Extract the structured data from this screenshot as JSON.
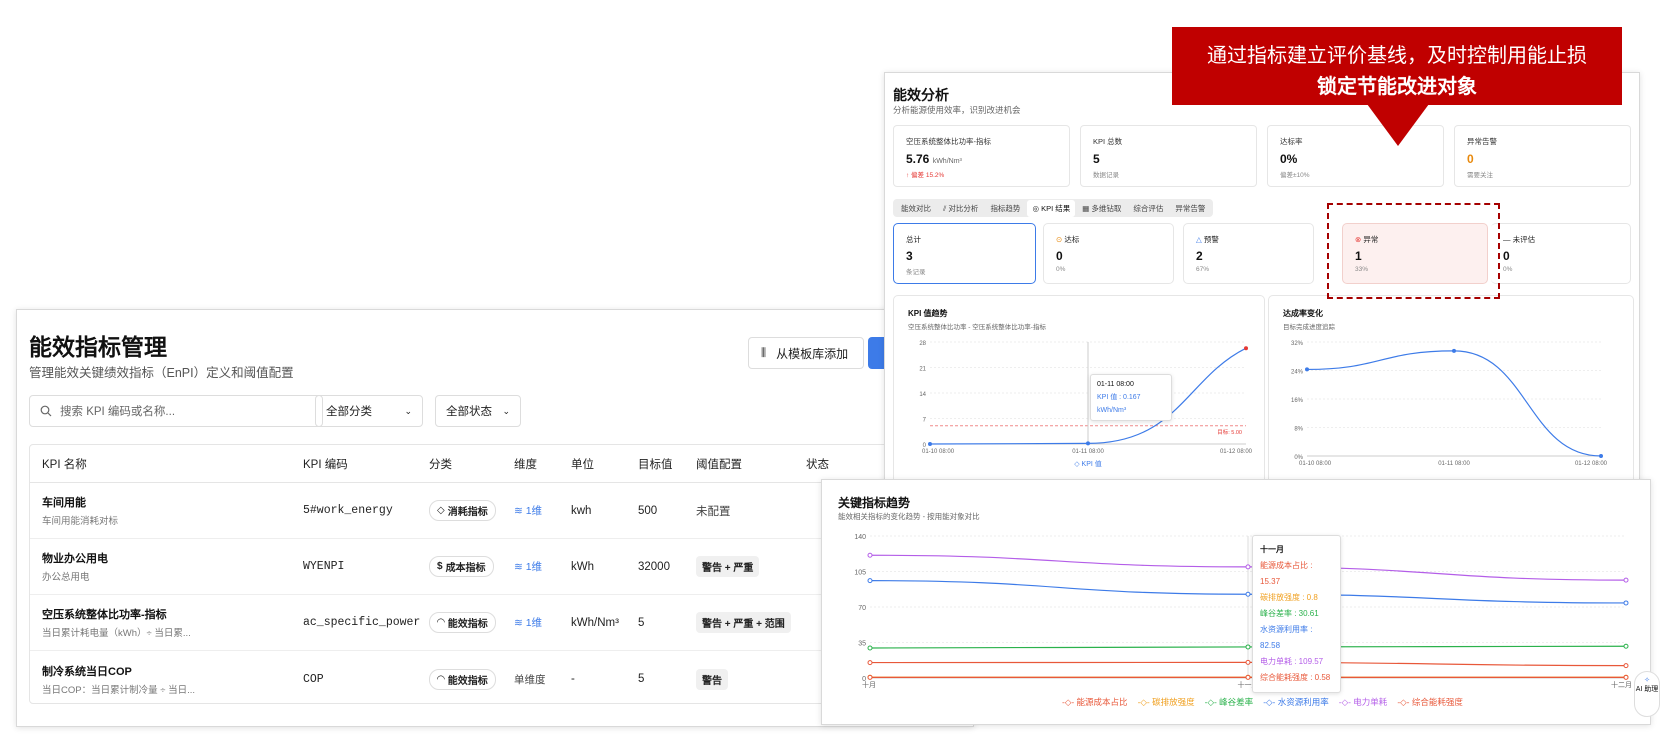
{
  "callout": {
    "line1": "通过指标建立评价基线，及时控制用能止损",
    "line2": "锁定节能改进对象"
  },
  "kpi_panel": {
    "title": "能效指标管理",
    "subtitle": "管理能效关键绩效指标（EnPI）定义和阈值配置",
    "template_btn": "从模板库添加",
    "search_placeholder": "搜索 KPI 编码或名称...",
    "filter_category": "全部分类",
    "filter_status": "全部状态",
    "columns": [
      "KPI 名称",
      "KPI 编码",
      "分类",
      "维度",
      "单位",
      "目标值",
      "阈值配置",
      "状态"
    ],
    "rows": [
      {
        "name": "车间用能",
        "desc": "车间用能消耗对标",
        "code": "5#work_energy",
        "category": "消耗指标",
        "cat_icon": "◇",
        "dimension": "1维",
        "unit": "kwh",
        "target": "500",
        "threshold": "未配置"
      },
      {
        "name": "物业办公用电",
        "desc": "办公总用电",
        "code": "WYENPI",
        "category": "成本指标",
        "cat_icon": "$",
        "dimension": "1维",
        "unit": "kWh",
        "target": "32000",
        "threshold": "警告 + 严重"
      },
      {
        "name": "空压系统整体比功率-指标",
        "desc": "当日累计耗电量（kWh）÷ 当日累...",
        "code": "ac_specific_power",
        "category": "能效指标",
        "cat_icon": "◠",
        "dimension": "1维",
        "unit": "kWh/Nm³",
        "target": "5",
        "threshold": "警告 + 严重 + 范围"
      },
      {
        "name": "制冷系统当日COP",
        "desc": "当日COP：当日累计制冷量 ÷ 当日...",
        "code": "COP",
        "category": "能效指标",
        "cat_icon": "◠",
        "dimension": "单维度",
        "unit": "-",
        "target": "5",
        "threshold": "警告"
      }
    ]
  },
  "ea_panel": {
    "title": "能效分析",
    "subtitle": "分析能源使用效率，识别改进机会",
    "stats": [
      {
        "label": "空压系统整体比功率-指标",
        "value": "5.76",
        "unit": "kWh/Nm³",
        "note": "↑ 偏差 15.2%",
        "note_color": "#e53935"
      },
      {
        "label": "KPI 总数",
        "value": "5",
        "unit": "",
        "note": "数据记录",
        "note_color": "#888"
      },
      {
        "label": "达标率",
        "value": "0%",
        "unit": "",
        "note": "偏差±10%",
        "note_color": "#888"
      },
      {
        "label": "异常告警",
        "value": "0",
        "unit": "",
        "note": "需要关注",
        "note_color": "#888",
        "value_color": "#e8890c"
      }
    ],
    "tabs": [
      "能效对比",
      "⫽ 对比分析",
      "指标趋势",
      "◎ KPI 结果",
      "▦ 多维钻取",
      "综合评估",
      "异常告警"
    ],
    "results": [
      {
        "label": "总计",
        "value": "3",
        "note": "条记录",
        "icon": ""
      },
      {
        "label": "达标",
        "value": "0",
        "note": "0%",
        "icon": "⊙"
      },
      {
        "label": "预警",
        "value": "2",
        "note": "67%",
        "icon": "△"
      },
      {
        "label": "异常",
        "value": "1",
        "note": "33%",
        "icon": "⊗"
      },
      {
        "label": "未评估",
        "value": "0",
        "note": "0%",
        "icon": "—"
      }
    ],
    "kpi_trend": {
      "title": "KPI 值趋势",
      "subtitle": "空压系统整体比功率 - 空压系统整体比功率-指标",
      "tooltip_time": "01-11 08:00",
      "tooltip_val": "KPI 值 : 0.167 kWh/Nm³",
      "target_label": "目标: 5.00",
      "legend": "KPI 值"
    },
    "rate_chart": {
      "title": "达成率变化",
      "subtitle": "目标完成进度追踪"
    }
  },
  "trend_panel": {
    "title": "关键指标趋势",
    "subtitle": "能效相关指标的变化趋势 - 按用能对象对比",
    "tooltip_title": "十一月",
    "tooltip_items": [
      {
        "text": "能源成本占比 : 15.37",
        "color": "#e8583a"
      },
      {
        "text": "碳排放强度 : 0.8",
        "color": "#f0a020"
      },
      {
        "text": "峰谷差率 : 30.61",
        "color": "#2bb24c"
      },
      {
        "text": "水资源利用率 : 82.58",
        "color": "#3d7be8"
      },
      {
        "text": "电力单耗 : 109.57",
        "color": "#b45ee8"
      },
      {
        "text": "综合能耗强度 : 0.58",
        "color": "#e8583a"
      }
    ],
    "ai_label": "AI 助理"
  },
  "chart_data": [
    {
      "type": "line",
      "title": "KPI 值趋势",
      "x": [
        "01-10 08:00",
        "01-11 08:00",
        "01-12 08:00"
      ],
      "series": [
        {
          "name": "KPI 值",
          "values": [
            0,
            0.167,
            26.3
          ]
        }
      ],
      "target": 5.0,
      "ylim": [
        0,
        28
      ],
      "yticks": [
        0,
        7,
        14,
        21,
        28
      ]
    },
    {
      "type": "line",
      "title": "达成率变化",
      "x": [
        "01-10 08:00",
        "01-11 08:00",
        "01-12 08:00"
      ],
      "series": [
        {
          "values": [
            24.3,
            29.5,
            0
          ]
        }
      ],
      "ylim": [
        0,
        32
      ],
      "yticks": [
        "0%",
        "8%",
        "16%",
        "24%",
        "32%"
      ]
    },
    {
      "type": "line",
      "title": "关键指标趋势",
      "x": [
        "十月",
        "十一月",
        "十二月"
      ],
      "ylim": [
        0,
        140
      ],
      "yticks": [
        0,
        35,
        70,
        105,
        140
      ],
      "series": [
        {
          "name": "能源成本占比",
          "values": [
            15.2,
            15.37,
            12.2
          ],
          "color": "#e8583a"
        },
        {
          "name": "碳排放强度",
          "values": [
            0.8,
            0.8,
            0.8
          ],
          "color": "#f0a020"
        },
        {
          "name": "峰谷差率",
          "values": [
            29.6,
            30.61,
            31.3
          ],
          "color": "#2bb24c"
        },
        {
          "name": "水资源利用率",
          "values": [
            96,
            82.58,
            74
          ],
          "color": "#3d7be8"
        },
        {
          "name": "电力单耗",
          "values": [
            121,
            109.57,
            96.5
          ],
          "color": "#b45ee8"
        },
        {
          "name": "综合能耗强度",
          "values": [
            0.58,
            0.58,
            0.58
          ],
          "color": "#e8583a"
        }
      ]
    }
  ]
}
